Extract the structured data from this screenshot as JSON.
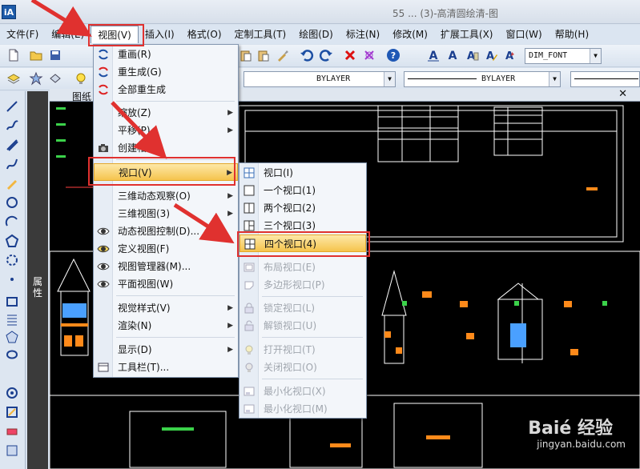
{
  "title": {
    "app_text": "iA",
    "window_text": "55 ... (3)-高清圆绘清-图"
  },
  "menubar": {
    "items": [
      "文件(F)",
      "编辑(E)",
      "视图(V)",
      "插入(I)",
      "格式(O)",
      "定制工具(T)",
      "绘图(D)",
      "标注(N)",
      "修改(M)",
      "扩展工具(X)",
      "窗口(W)",
      "帮助(H)"
    ]
  },
  "toolbar": {
    "text_style": "DIM_FONT",
    "layer_linetype": "BYLAYER",
    "layer_lineweight": "BYLAYER",
    "color_swatch": "#7fe8f5"
  },
  "tab": {
    "label": "图纸"
  },
  "properties_panel": {
    "label": "属性"
  },
  "view_menu": {
    "items": [
      {
        "label": "重画(R)",
        "icon": "redraw-icon",
        "submenu": false
      },
      {
        "label": "重生成(G)",
        "icon": "regen-icon",
        "submenu": false
      },
      {
        "label": "全部重生成",
        "icon": "regen-all-icon",
        "submenu": false
      },
      {
        "label": "缩放(Z)",
        "icon": "",
        "submenu": true
      },
      {
        "label": "平移(P)",
        "icon": "",
        "submenu": true
      },
      {
        "label": "创建相机",
        "icon": "camera-icon",
        "submenu": false
      },
      {
        "label": "视口(V)",
        "icon": "",
        "submenu": true,
        "highlight": true
      },
      {
        "label": "三维动态观察(O)",
        "icon": "",
        "submenu": true
      },
      {
        "label": "三维视图(3)",
        "icon": "",
        "submenu": true
      },
      {
        "label": "动态视图控制(D)...",
        "icon": "eye-icon",
        "submenu": false
      },
      {
        "label": "定义视图(F)",
        "icon": "eye-icon",
        "submenu": false
      },
      {
        "label": "视图管理器(M)...",
        "icon": "eye-icon",
        "submenu": false
      },
      {
        "label": "平面视图(W)",
        "icon": "eye-icon",
        "submenu": false
      },
      {
        "label": "视觉样式(V)",
        "icon": "",
        "submenu": true
      },
      {
        "label": "渲染(N)",
        "icon": "",
        "submenu": true
      },
      {
        "label": "显示(D)",
        "icon": "",
        "submenu": true
      },
      {
        "label": "工具栏(T)...",
        "icon": "toolbar-icon",
        "submenu": false
      }
    ]
  },
  "viewport_submenu": {
    "items": [
      {
        "label": "视口(I)",
        "disabled": false
      },
      {
        "label": "一个视口(1)",
        "disabled": false
      },
      {
        "label": "两个视口(2)",
        "disabled": false
      },
      {
        "label": "三个视口(3)",
        "disabled": false
      },
      {
        "label": "四个视口(4)",
        "disabled": false,
        "highlight": true
      },
      {
        "label": "布局视口(E)",
        "disabled": true
      },
      {
        "label": "多边形视口(P)",
        "disabled": true
      },
      {
        "label": "锁定视口(L)",
        "disabled": true
      },
      {
        "label": "解锁视口(U)",
        "disabled": true
      },
      {
        "label": "打开视口(T)",
        "disabled": true
      },
      {
        "label": "关闭视口(O)",
        "disabled": true
      },
      {
        "label": "最小化视口(X)",
        "disabled": true
      },
      {
        "label": "最小化视口(M)",
        "disabled": true
      }
    ]
  },
  "watermark": {
    "text": "Baié 经验",
    "url": "jingyan.baidu.com"
  },
  "colors": {
    "accent_red": "#e0312f",
    "highlight": "#f5c44d",
    "drawing_bg": "#000000"
  }
}
